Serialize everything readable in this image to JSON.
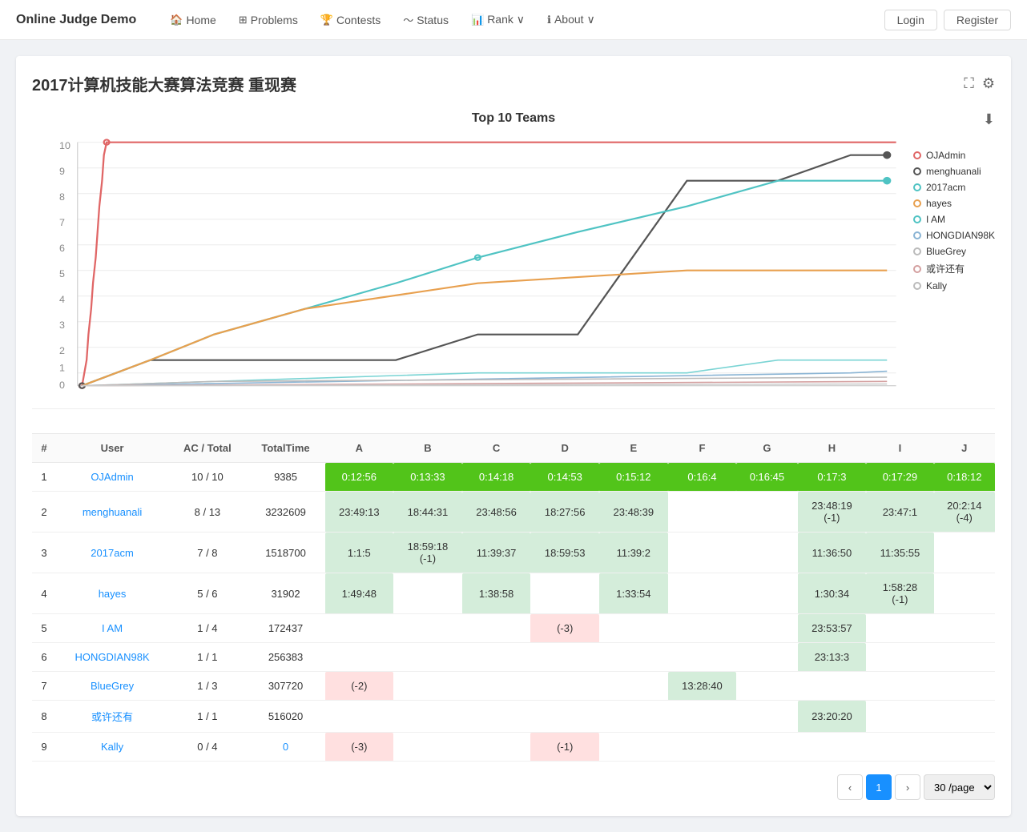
{
  "site": {
    "brand": "Online Judge Demo"
  },
  "navbar": {
    "items": [
      {
        "label": "Home",
        "icon": "🏠"
      },
      {
        "label": "Problems",
        "icon": "⊞"
      },
      {
        "label": "Contests",
        "icon": "🏆"
      },
      {
        "label": "Status",
        "icon": "📊"
      },
      {
        "label": "Rank ∨",
        "icon": "📈"
      },
      {
        "label": "About ∨",
        "icon": "ℹ"
      }
    ],
    "login": "Login",
    "register": "Register"
  },
  "page": {
    "title": "2017计算机技能大赛算法竞赛 重现赛",
    "chart_title": "Top 10 Teams",
    "download_icon": "⬇",
    "fullscreen_icon": "⛶",
    "settings_icon": "⚙"
  },
  "legend": [
    {
      "label": "OJAdmin",
      "color": "#e06666"
    },
    {
      "label": "menghuanali",
      "color": "#555"
    },
    {
      "label": "2017acm",
      "color": "#4fc3c3"
    },
    {
      "label": "hayes",
      "color": "#e8a04f"
    },
    {
      "label": "I AM",
      "color": "#4fc3c3"
    },
    {
      "label": "HONGDIAN98K",
      "color": "#8ab4d4"
    },
    {
      "label": "BlueGrey",
      "color": "#bbb"
    },
    {
      "label": "或许还有",
      "color": "#d4a0a0"
    },
    {
      "label": "Kally",
      "color": "#bbb"
    }
  ],
  "table": {
    "headers": [
      "#",
      "User",
      "AC / Total",
      "TotalTime",
      "A",
      "B",
      "C",
      "D",
      "E",
      "F",
      "G",
      "H",
      "I",
      "J"
    ],
    "rows": [
      {
        "rank": 1,
        "user": "OJAdmin",
        "ac_total": "10 / 10",
        "total_time": "9385",
        "cells": [
          {
            "val": "0:12:56",
            "type": "green"
          },
          {
            "val": "0:13:33",
            "type": "green"
          },
          {
            "val": "0:14:18",
            "type": "green"
          },
          {
            "val": "0:14:53",
            "type": "green"
          },
          {
            "val": "0:15:12",
            "type": "green"
          },
          {
            "val": "0:16:4",
            "type": "green"
          },
          {
            "val": "0:16:45",
            "type": "green"
          },
          {
            "val": "0:17:3",
            "type": "green"
          },
          {
            "val": "0:17:29",
            "type": "green"
          },
          {
            "val": "0:18:12",
            "type": "green"
          }
        ]
      },
      {
        "rank": 2,
        "user": "menghuanali",
        "ac_total": "8 / 13",
        "total_time": "3232609",
        "cells": [
          {
            "val": "23:49:13",
            "type": "light-green"
          },
          {
            "val": "18:44:31",
            "type": "light-green"
          },
          {
            "val": "23:48:56",
            "type": "light-green"
          },
          {
            "val": "18:27:56",
            "type": "light-green"
          },
          {
            "val": "23:48:39",
            "type": "light-green"
          },
          {
            "val": "",
            "type": ""
          },
          {
            "val": "",
            "type": ""
          },
          {
            "val": "23:48:19\n(-1)",
            "type": "light-green"
          },
          {
            "val": "23:47:1",
            "type": "light-green"
          },
          {
            "val": "20:2:14\n(-4)",
            "type": "light-green"
          }
        ]
      },
      {
        "rank": 3,
        "user": "2017acm",
        "ac_total": "7 / 8",
        "total_time": "1518700",
        "cells": [
          {
            "val": "1:1:5",
            "type": "light-green"
          },
          {
            "val": "18:59:18\n(-1)",
            "type": "light-green"
          },
          {
            "val": "11:39:37",
            "type": "light-green"
          },
          {
            "val": "18:59:53",
            "type": "light-green"
          },
          {
            "val": "11:39:2",
            "type": "light-green"
          },
          {
            "val": "",
            "type": ""
          },
          {
            "val": "",
            "type": ""
          },
          {
            "val": "11:36:50",
            "type": "light-green"
          },
          {
            "val": "11:35:55",
            "type": "light-green"
          },
          {
            "val": "",
            "type": ""
          }
        ]
      },
      {
        "rank": 4,
        "user": "hayes",
        "ac_total": "5 / 6",
        "total_time": "31902",
        "cells": [
          {
            "val": "1:49:48",
            "type": "light-green"
          },
          {
            "val": "",
            "type": ""
          },
          {
            "val": "1:38:58",
            "type": "light-green"
          },
          {
            "val": "",
            "type": ""
          },
          {
            "val": "1:33:54",
            "type": "light-green"
          },
          {
            "val": "",
            "type": ""
          },
          {
            "val": "",
            "type": ""
          },
          {
            "val": "1:30:34",
            "type": "light-green"
          },
          {
            "val": "1:58:28\n(-1)",
            "type": "light-green"
          },
          {
            "val": "",
            "type": ""
          }
        ]
      },
      {
        "rank": 5,
        "user": "I AM",
        "ac_total": "1 / 4",
        "total_time": "172437",
        "cells": [
          {
            "val": "",
            "type": ""
          },
          {
            "val": "",
            "type": ""
          },
          {
            "val": "",
            "type": ""
          },
          {
            "val": "(-3)",
            "type": "pink"
          },
          {
            "val": "",
            "type": ""
          },
          {
            "val": "",
            "type": ""
          },
          {
            "val": "",
            "type": ""
          },
          {
            "val": "23:53:57",
            "type": "light-green"
          },
          {
            "val": "",
            "type": ""
          },
          {
            "val": "",
            "type": ""
          }
        ]
      },
      {
        "rank": 6,
        "user": "HONGDIAN98K",
        "ac_total": "1 / 1",
        "total_time": "256383",
        "cells": [
          {
            "val": "",
            "type": ""
          },
          {
            "val": "",
            "type": ""
          },
          {
            "val": "",
            "type": ""
          },
          {
            "val": "",
            "type": ""
          },
          {
            "val": "",
            "type": ""
          },
          {
            "val": "",
            "type": ""
          },
          {
            "val": "",
            "type": ""
          },
          {
            "val": "23:13:3",
            "type": "light-green"
          },
          {
            "val": "",
            "type": ""
          },
          {
            "val": "",
            "type": ""
          }
        ]
      },
      {
        "rank": 7,
        "user": "BlueGrey",
        "ac_total": "1 / 3",
        "total_time": "307720",
        "cells": [
          {
            "val": "(-2)",
            "type": "pink"
          },
          {
            "val": "",
            "type": ""
          },
          {
            "val": "",
            "type": ""
          },
          {
            "val": "",
            "type": ""
          },
          {
            "val": "",
            "type": ""
          },
          {
            "val": "13:28:40",
            "type": "light-green"
          },
          {
            "val": "",
            "type": ""
          },
          {
            "val": "",
            "type": ""
          },
          {
            "val": "",
            "type": ""
          },
          {
            "val": "",
            "type": ""
          }
        ]
      },
      {
        "rank": 8,
        "user": "或许还有",
        "ac_total": "1 / 1",
        "total_time": "516020",
        "cells": [
          {
            "val": "",
            "type": ""
          },
          {
            "val": "",
            "type": ""
          },
          {
            "val": "",
            "type": ""
          },
          {
            "val": "",
            "type": ""
          },
          {
            "val": "",
            "type": ""
          },
          {
            "val": "",
            "type": ""
          },
          {
            "val": "",
            "type": ""
          },
          {
            "val": "23:20:20",
            "type": "light-green"
          },
          {
            "val": "",
            "type": ""
          },
          {
            "val": "",
            "type": ""
          }
        ]
      },
      {
        "rank": 9,
        "user": "Kally",
        "ac_total": "0 / 4",
        "total_time": "0",
        "cells": [
          {
            "val": "(-3)",
            "type": "pink"
          },
          {
            "val": "",
            "type": ""
          },
          {
            "val": "",
            "type": ""
          },
          {
            "val": "(-1)",
            "type": "pink"
          },
          {
            "val": "",
            "type": ""
          },
          {
            "val": "",
            "type": ""
          },
          {
            "val": "",
            "type": ""
          },
          {
            "val": "",
            "type": ""
          },
          {
            "val": "",
            "type": ""
          },
          {
            "val": "",
            "type": ""
          }
        ]
      }
    ]
  },
  "pagination": {
    "prev": "‹",
    "next": "›",
    "current": "1",
    "page_size": "30 /page"
  }
}
